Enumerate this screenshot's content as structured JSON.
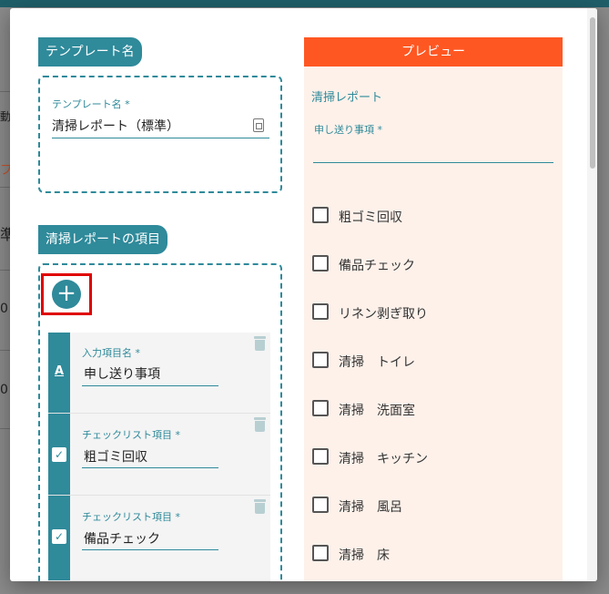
{
  "background": {
    "fragments": [
      "動",
      "プ",
      "準",
      "0",
      "0"
    ]
  },
  "template_section": {
    "chip_label": "テンプレート名",
    "field_label": "テンプレート名 *",
    "field_value": "清掃レポート（標準）"
  },
  "items_section": {
    "chip_label": "清掃レポートの項目",
    "add_button_label": "+",
    "items": [
      {
        "type_icon": "A",
        "type": "text",
        "label": "入力項目名 *",
        "value": "申し送り事項"
      },
      {
        "type_icon": "✓",
        "type": "checklist",
        "label": "チェックリスト項目 *",
        "value": "粗ゴミ回収"
      },
      {
        "type_icon": "✓",
        "type": "checklist",
        "label": "チェックリスト項目 *",
        "value": "備品チェック"
      }
    ]
  },
  "preview": {
    "header": "プレビュー",
    "title": "清掃レポート",
    "field_label": "申し送り事項 *",
    "checklist": [
      "粗ゴミ回収",
      "備品チェック",
      "リネン剥ぎ取り",
      "清掃　トイレ",
      "清掃　洗面室",
      "清掃　キッチン",
      "清掃　風呂",
      "清掃　床"
    ]
  },
  "colors": {
    "accent": "#2f8a9a",
    "preview_header": "#ff5722",
    "preview_bg": "#fdf1ea",
    "highlight": "#e00000"
  }
}
